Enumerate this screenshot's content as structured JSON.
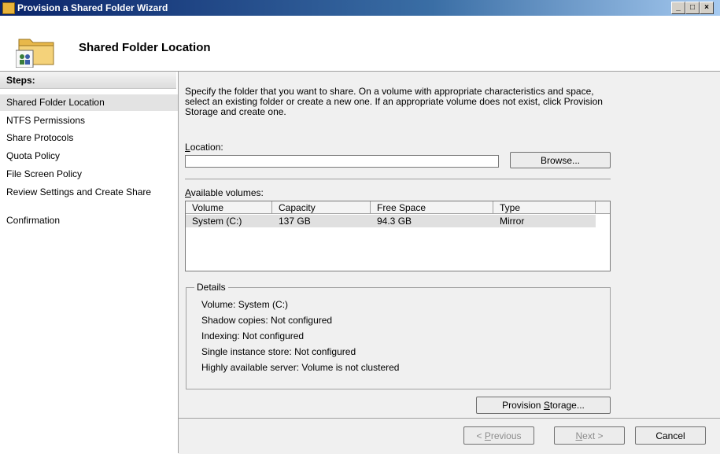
{
  "window": {
    "title": "Provision a Shared Folder Wizard",
    "controls": [
      "_",
      "□",
      "×"
    ]
  },
  "header": {
    "title": "Shared Folder Location",
    "icon": "shared-folder-icon"
  },
  "steps": {
    "title": "Steps:",
    "items": [
      {
        "label": "Shared Folder Location",
        "active": true
      },
      {
        "label": "NTFS Permissions",
        "active": false
      },
      {
        "label": "Share Protocols",
        "active": false
      },
      {
        "label": "Quota Policy",
        "active": false
      },
      {
        "label": "File Screen Policy",
        "active": false
      },
      {
        "label": "Review Settings and Create Share",
        "active": false
      },
      {
        "label": "Confirmation",
        "active": false
      }
    ]
  },
  "main": {
    "description": "Specify the folder that you want to share. On a volume with appropriate characteristics and space, select an existing folder or create a new one. If an appropriate volume does not exist, click Provision Storage and create one.",
    "location": {
      "label_access": "L",
      "label_rest": "ocation:",
      "value": "",
      "placeholder": ""
    },
    "browse_label": "Browse...",
    "volumes_label_access": "A",
    "volumes_label_rest": "vailable volumes:",
    "table": {
      "columns": [
        "Volume",
        "Capacity",
        "Free Space",
        "Type"
      ],
      "rows": [
        [
          "System  (C:)",
          "137 GB",
          "94.3 GB",
          "Mirror"
        ]
      ]
    },
    "details": {
      "legend": "Details",
      "volume": "Volume:   System  (C:)",
      "shadow": "Shadow copies:   Not configured",
      "indexing": "Indexing:   Not configured",
      "sis": "Single instance store:   Not configured",
      "ha": "Highly available server:   Volume is not clustered"
    },
    "provision_label_pre": "Provision ",
    "provision_label_access": "S",
    "provision_label_post": "torage..."
  },
  "footer": {
    "previous_pre": "< ",
    "previous_access": "P",
    "previous_post": "revious",
    "next_access": "N",
    "next_post": "ext >",
    "cancel": "Cancel"
  }
}
